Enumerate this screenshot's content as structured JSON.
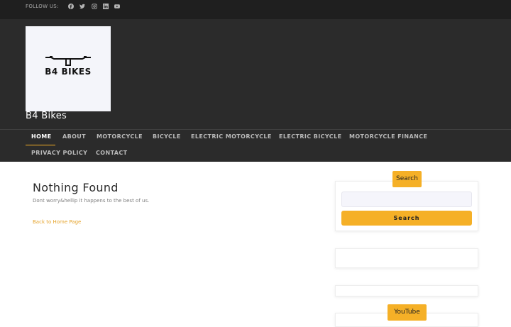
{
  "topbar": {
    "follow_label": "FOLLOW US:",
    "social_icons": [
      "facebook-icon",
      "twitter-icon",
      "instagram-icon",
      "linkedin-icon",
      "youtube-icon"
    ]
  },
  "header": {
    "logo_text": "B4 BIKES",
    "site_title": "B4 Bikes"
  },
  "nav": {
    "items": [
      "HOME",
      "ABOUT",
      "MOTORCYCLE",
      "BICYCLE",
      "ELECTRIC MOTORCYCLE",
      "ELECTRIC BICYCLE",
      "MOTORCYCLE FINANCE",
      "PRIVACY POLICY",
      "CONTACT"
    ],
    "active": "HOME"
  },
  "content": {
    "title": "Nothing Found",
    "message": "Dont worry&hellip it happens to the best of us.",
    "back_link": "Back to Home Page"
  },
  "sidebar": {
    "search_widget_title": "Search",
    "search_placeholder": "",
    "search_button": "Search",
    "youtube_widget_title": "YouTube"
  },
  "colors": {
    "accent": "#f5b027",
    "topbar_bg": "#1f1f1f",
    "header_bg": "#2b2b2b"
  }
}
